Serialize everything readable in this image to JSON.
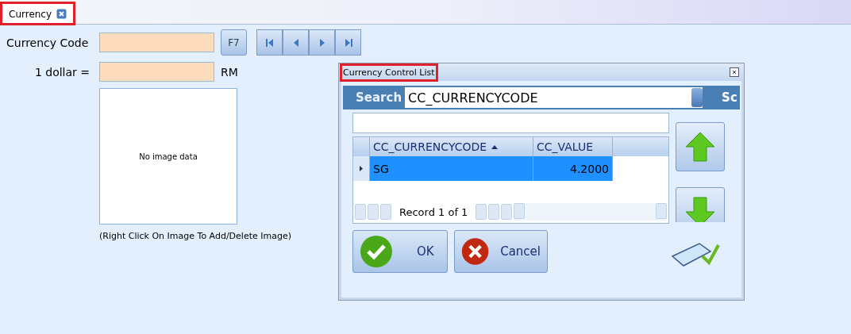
{
  "tabs": [
    {
      "label": "Currency",
      "selected": true,
      "highlighted": true
    }
  ],
  "form": {
    "code_label": "Currency Code",
    "f7_label": "F7",
    "rate_label": "1 dollar =",
    "rate_unit": "RM",
    "image_placeholder": "No image data",
    "image_hint": "(Right Click On Image To Add/Delete Image)"
  },
  "dialog": {
    "title": "Currency Control List",
    "title_highlighted": true,
    "search_label": "Search",
    "search_field": "CC_CURRENCYCODE",
    "search_cut_text": "Sc",
    "table": {
      "columns": [
        {
          "label": "CC_CURRENCYCODE",
          "sorted": true
        },
        {
          "label": "CC_VALUE",
          "sorted": false
        }
      ],
      "rows": [
        {
          "cells": [
            "SG",
            "4.2000"
          ],
          "selected": true
        }
      ]
    },
    "record_text": "Record 1 of 1",
    "ok_label": "OK",
    "cancel_label": "Cancel"
  }
}
